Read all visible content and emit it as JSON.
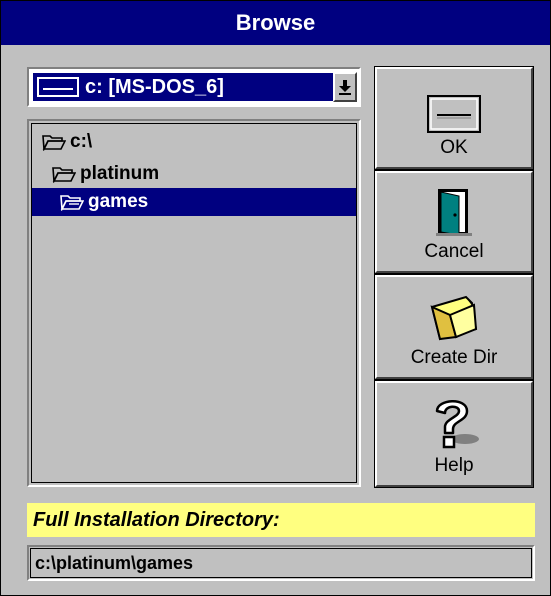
{
  "window": {
    "title": "Browse"
  },
  "drive": {
    "selected": "c: [MS-DOS_6]",
    "dropdown_icon": "arrow-down-icon"
  },
  "tree": {
    "items": [
      {
        "label": "c:\\",
        "icon": "folder-open-icon",
        "selected": false
      },
      {
        "label": "platinum",
        "icon": "folder-open-icon",
        "selected": false
      },
      {
        "label": "games",
        "icon": "folder-open-icon",
        "selected": true
      }
    ]
  },
  "buttons": {
    "ok": "OK",
    "cancel": "Cancel",
    "create_dir": "Create Dir",
    "help": "Help"
  },
  "install": {
    "label": "Full Installation Directory:",
    "value": "c:\\platinum\\games"
  }
}
